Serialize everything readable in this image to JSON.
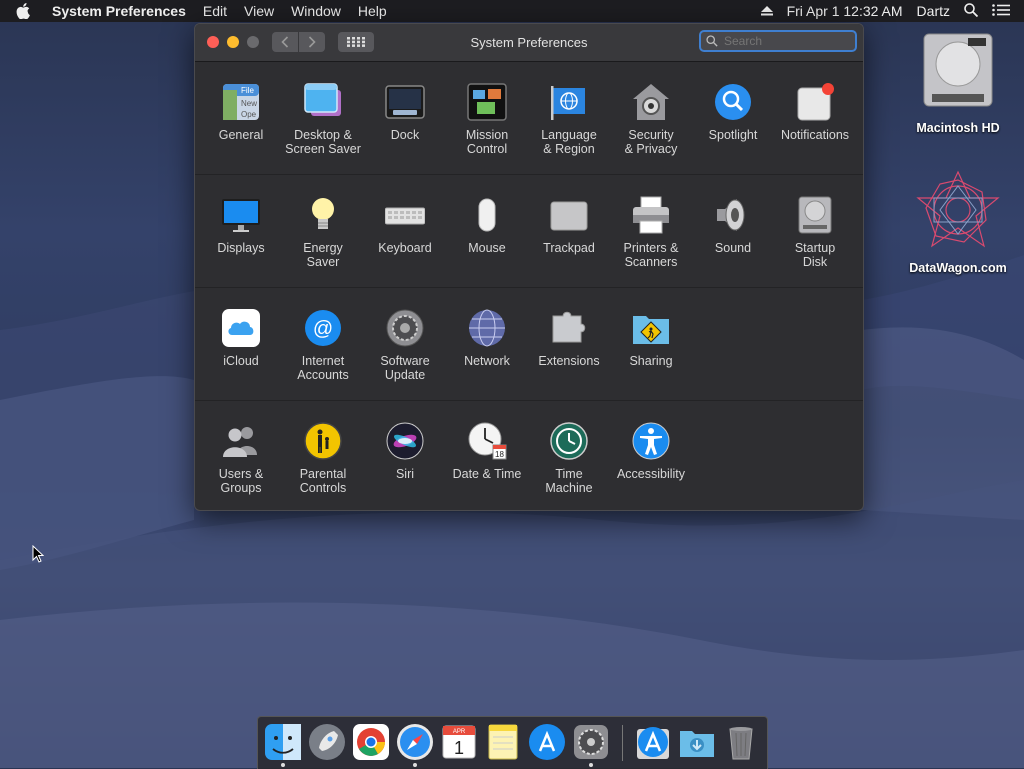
{
  "menubar": {
    "app_name": "System Preferences",
    "menus": [
      "Edit",
      "View",
      "Window",
      "Help"
    ],
    "clock": "Fri Apr 1  12:32 AM",
    "user": "Dartz"
  },
  "window": {
    "title": "System Preferences",
    "search_placeholder": "Search",
    "sections": [
      [
        {
          "label": "General",
          "icon": "general-icon"
        },
        {
          "label": "Desktop &\nScreen Saver",
          "icon": "desktop-icon"
        },
        {
          "label": "Dock",
          "icon": "dock-icon"
        },
        {
          "label": "Mission\nControl",
          "icon": "mission-control-icon"
        },
        {
          "label": "Language\n& Region",
          "icon": "flag-globe-icon"
        },
        {
          "label": "Security\n& Privacy",
          "icon": "house-lock-icon"
        },
        {
          "label": "Spotlight",
          "icon": "magnifier-icon"
        },
        {
          "label": "Notifications",
          "icon": "notification-badge-icon"
        }
      ],
      [
        {
          "label": "Displays",
          "icon": "monitor-icon"
        },
        {
          "label": "Energy\nSaver",
          "icon": "lightbulb-icon"
        },
        {
          "label": "Keyboard",
          "icon": "keyboard-icon"
        },
        {
          "label": "Mouse",
          "icon": "mouse-icon"
        },
        {
          "label": "Trackpad",
          "icon": "trackpad-icon"
        },
        {
          "label": "Printers &\nScanners",
          "icon": "printer-icon"
        },
        {
          "label": "Sound",
          "icon": "speaker-icon"
        },
        {
          "label": "Startup\nDisk",
          "icon": "hard-disk-icon"
        }
      ],
      [
        {
          "label": "iCloud",
          "icon": "cloud-icon"
        },
        {
          "label": "Internet\nAccounts",
          "icon": "at-sign-icon"
        },
        {
          "label": "Software\nUpdate",
          "icon": "gear-icon"
        },
        {
          "label": "Network",
          "icon": "globe-icon"
        },
        {
          "label": "Extensions",
          "icon": "puzzle-icon"
        },
        {
          "label": "Sharing",
          "icon": "folder-sign-icon"
        }
      ],
      [
        {
          "label": "Users &\nGroups",
          "icon": "users-icon"
        },
        {
          "label": "Parental\nControls",
          "icon": "parent-child-icon"
        },
        {
          "label": "Siri",
          "icon": "siri-icon"
        },
        {
          "label": "Date & Time",
          "icon": "clock-calendar-icon"
        },
        {
          "label": "Time\nMachine",
          "icon": "time-machine-icon"
        },
        {
          "label": "Accessibility",
          "icon": "accessibility-icon"
        }
      ]
    ]
  },
  "desktop": {
    "icons": [
      {
        "label": "Macintosh HD"
      },
      {
        "label": "DataWagon.com"
      }
    ]
  },
  "calendar_day": "1",
  "calendar_month": "APR",
  "clock_day": "18"
}
